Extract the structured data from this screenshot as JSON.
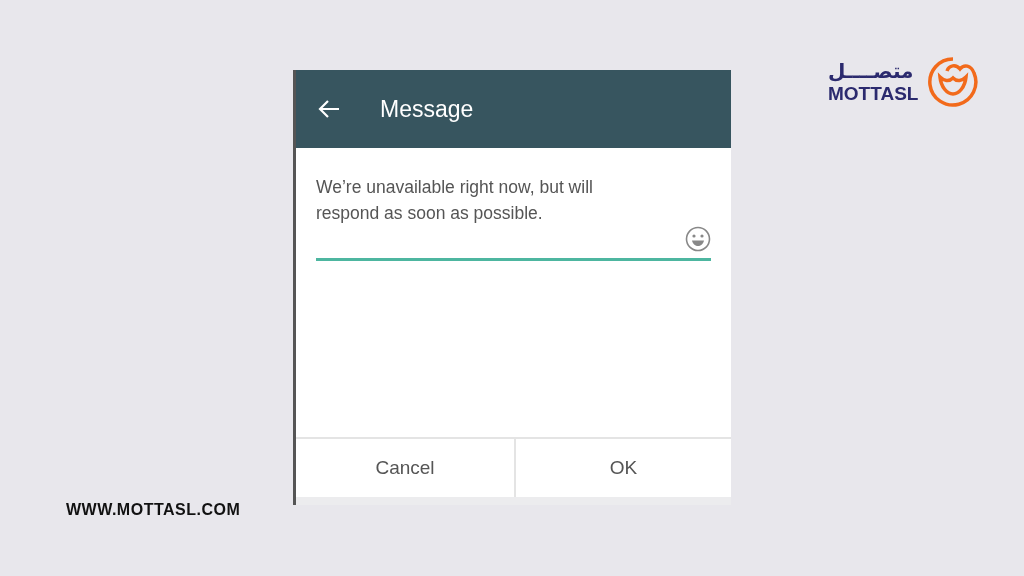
{
  "brand": {
    "arabic_name": "متصــــل",
    "name": "MOTTASL",
    "url": "WWW.MOTTASL.COM"
  },
  "dialog": {
    "title": "Message",
    "message": "We’re unavailable right now, but will respond as soon as possible.",
    "buttons": [
      "Cancel",
      "OK"
    ]
  }
}
